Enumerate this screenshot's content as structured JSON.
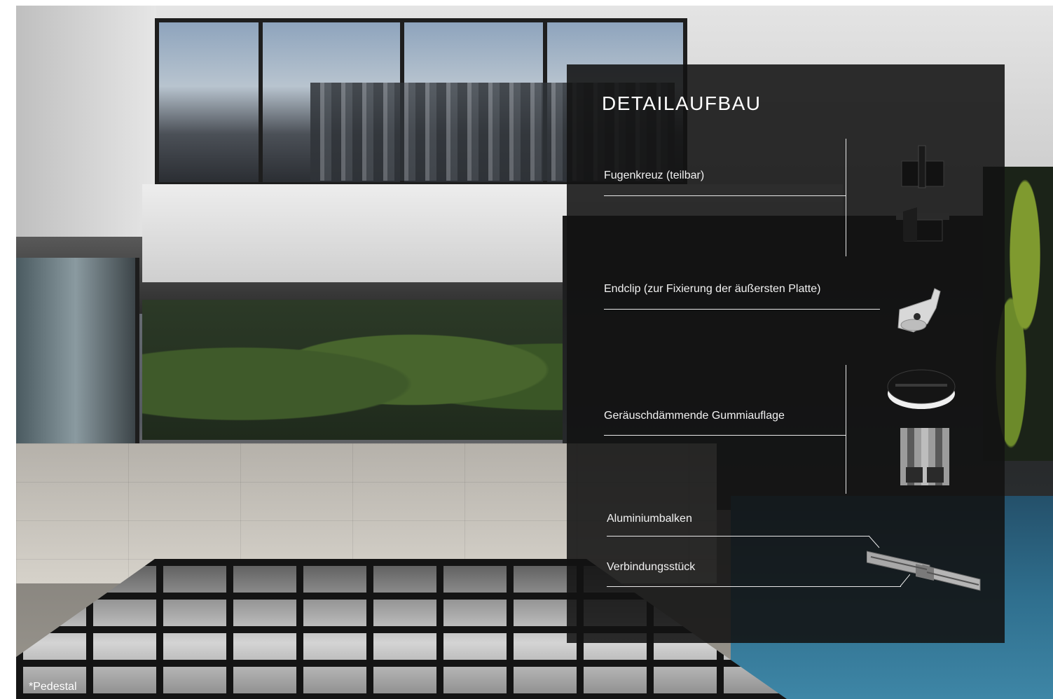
{
  "panel": {
    "title": "DETAILAUFBAU",
    "items": [
      {
        "label": "Fugenkreuz (teilbar)",
        "icon": "joint-cross-icon"
      },
      {
        "label": "Endclip (zur Fixierung der äußersten Platte)",
        "icon": "end-clip-icon"
      },
      {
        "label": "Geräuschdämmende Gummiauflage",
        "icon": "rubber-pad-icon"
      },
      {
        "label": "Aluminiumbalken",
        "icon": "aluminium-beam-icon"
      },
      {
        "label": "Verbindungsstück",
        "icon": "connector-icon"
      }
    ]
  },
  "footnote": "*Pedestal",
  "colors": {
    "panel_background": "#121212",
    "text": "#ffffff",
    "rule": "#e8e8e8"
  }
}
